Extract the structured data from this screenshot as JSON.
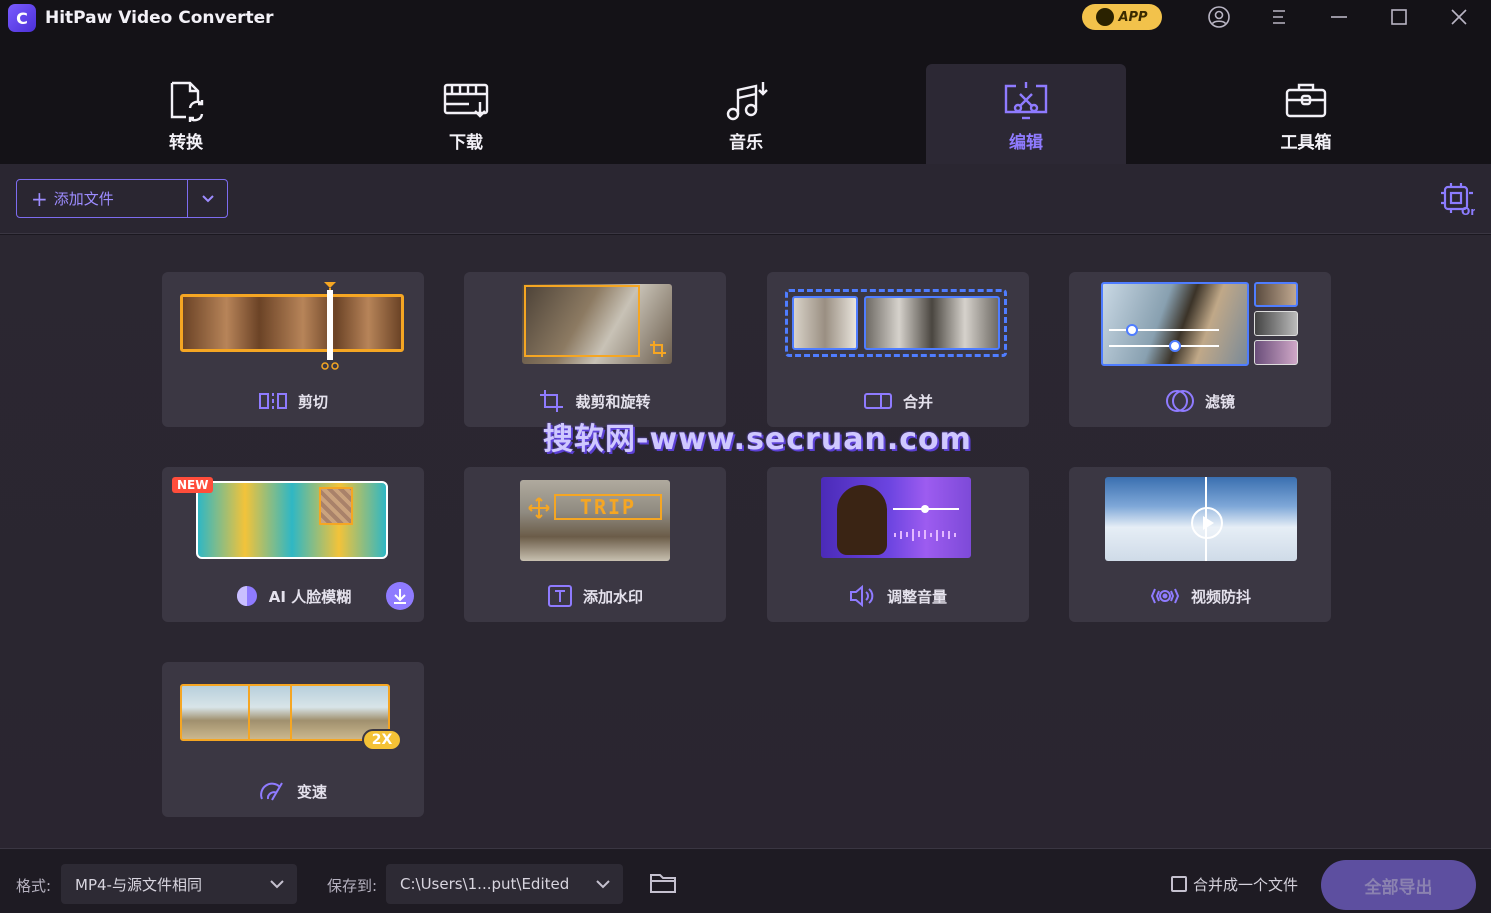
{
  "app": {
    "title": "HitPaw Video Converter",
    "logo_letter": "C",
    "app_badge": "APP"
  },
  "nav": {
    "tabs": [
      {
        "label": "转换",
        "icon": "convert-icon"
      },
      {
        "label": "下载",
        "icon": "download-film-icon"
      },
      {
        "label": "音乐",
        "icon": "music-icon"
      },
      {
        "label": "编辑",
        "icon": "edit-icon",
        "active": true
      },
      {
        "label": "工具箱",
        "icon": "toolbox-icon"
      }
    ]
  },
  "toolbar": {
    "add_file_label": "添加文件"
  },
  "cards": [
    {
      "label": "剪切",
      "icon": "cut-icon"
    },
    {
      "label": "裁剪和旋转",
      "icon": "crop-icon"
    },
    {
      "label": "合并",
      "icon": "merge-icon"
    },
    {
      "label": "滤镜",
      "icon": "filter-icon"
    },
    {
      "label": "AI 人脸模糊",
      "icon": "face-blur-icon",
      "badge": "NEW"
    },
    {
      "label": "添加水印",
      "icon": "watermark-icon",
      "thumb_text": "TRIP"
    },
    {
      "label": "调整音量",
      "icon": "volume-icon"
    },
    {
      "label": "视频防抖",
      "icon": "stabilize-icon"
    },
    {
      "label": "变速",
      "icon": "speed-icon",
      "badge": "2X"
    }
  ],
  "watermark_text": "搜软网-www.secruan.com",
  "footer": {
    "format_label": "格式:",
    "format_value": "MP4-与源文件相同",
    "save_label": "保存到:",
    "save_value": "C:\\Users\\1...put\\Edited",
    "merge_label": "合并成一个文件",
    "export_all_label": "全部导出"
  },
  "colors": {
    "accent": "#8f7bff",
    "badge_new": "#ff4d3b",
    "badge_speed": "#f4c236",
    "thumb_frame_orange": "#f5a623",
    "thumb_frame_blue": "#4f7dff"
  }
}
